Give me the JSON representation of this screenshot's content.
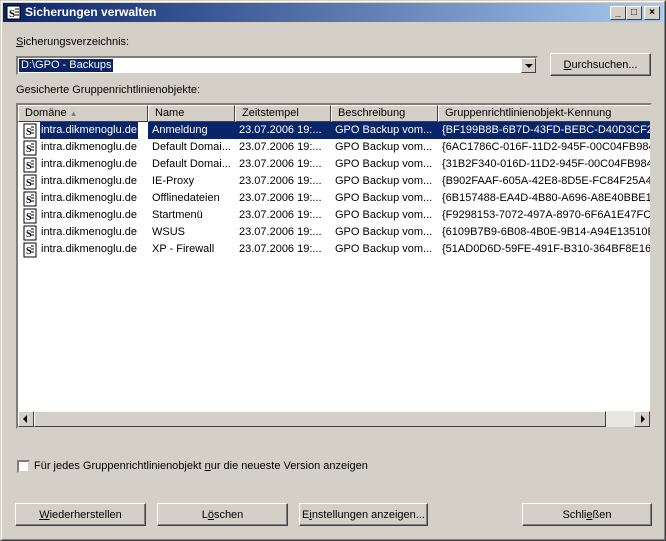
{
  "window": {
    "title": "Sicherungen verwalten",
    "minimize": "_",
    "maximize": "□",
    "close": "×"
  },
  "directory": {
    "label_u": "S",
    "label_rest": "icherungsverzeichnis:",
    "value": "D:\\GPO - Backups",
    "browse_u": "D",
    "browse_rest": "urchsuchen..."
  },
  "list_label": "Gesicherte Gruppenrichtlinienobjekte:",
  "columns": [
    "Domäne",
    "Name",
    "Zeitstempel",
    "Beschreibung",
    "Gruppenrichtlinienobjekt-Kennung"
  ],
  "rows": [
    [
      "intra.dikmenoglu.de",
      "Anmeldung",
      "23.07.2006 19:...",
      "GPO Backup vom...",
      "{BF199B8B-6B7D-43FD-BEBC-D40D3CF2C"
    ],
    [
      "intra.dikmenoglu.de",
      "Default Domai...",
      "23.07.2006 19:...",
      "GPO Backup vom...",
      "{6AC1786C-016F-11D2-945F-00C04FB984F"
    ],
    [
      "intra.dikmenoglu.de",
      "Default Domai...",
      "23.07.2006 19:...",
      "GPO Backup vom...",
      "{31B2F340-016D-11D2-945F-00C04FB984F"
    ],
    [
      "intra.dikmenoglu.de",
      "IE-Proxy",
      "23.07.2006 19:...",
      "GPO Backup vom...",
      "{B902FAAF-605A-42E8-8D5E-FC84F25A41"
    ],
    [
      "intra.dikmenoglu.de",
      "Offlinedateien",
      "23.07.2006 19:...",
      "GPO Backup vom...",
      "{6B157488-EA4D-4B80-A696-A8E40BBE1F"
    ],
    [
      "intra.dikmenoglu.de",
      "Startmenü",
      "23.07.2006 19:...",
      "GPO Backup vom...",
      "{F9298153-7072-497A-8970-6F6A1E47FCD"
    ],
    [
      "intra.dikmenoglu.de",
      "WSUS",
      "23.07.2006 19:...",
      "GPO Backup vom...",
      "{6109B7B9-6B08-4B0E-9B14-A94E13510E"
    ],
    [
      "intra.dikmenoglu.de",
      "XP - Firewall",
      "23.07.2006 19:...",
      "GPO Backup vom...",
      "{51AD0D6D-59FE-491F-B310-364BF8E168"
    ]
  ],
  "checkbox": {
    "pre": "Für jedes Gruppenrichtlinienobjekt ",
    "u": "n",
    "post": "ur die neueste Version anzeigen",
    "checked": false
  },
  "buttons": {
    "restore": {
      "u": "W",
      "rest": "iederherstellen"
    },
    "delete_pre": "L",
    "delete_u": "ö",
    "delete_post": "schen",
    "settings_pre": "E",
    "settings_u": "i",
    "settings_post": "nstellungen anzeigen...",
    "close_pre": "Schli",
    "close_u": "e",
    "close_post": "ßen"
  }
}
